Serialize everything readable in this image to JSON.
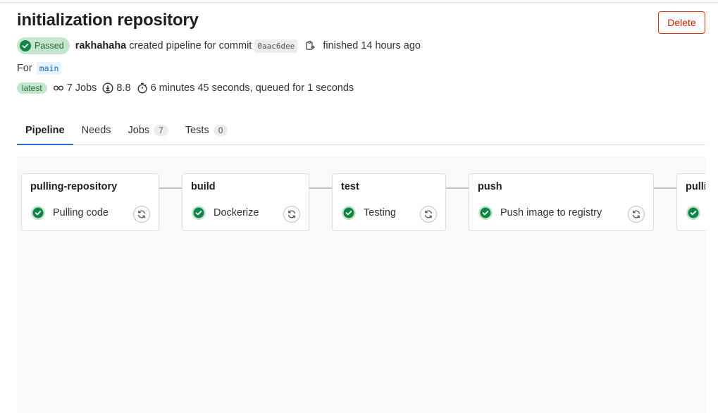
{
  "header": {
    "title": "initialization repository",
    "delete_label": "Delete"
  },
  "meta": {
    "status": "Passed",
    "author": "rakhahaha",
    "created_text": "created pipeline for commit",
    "sha": "0aac6dee",
    "finished_text": "finished 14 hours ago"
  },
  "ref": {
    "for_label": "For",
    "branch": "main"
  },
  "stats": {
    "latest_label": "latest",
    "jobs": "7 Jobs",
    "score": "8.8",
    "duration": "6 minutes 45 seconds, queued for 1 seconds"
  },
  "tabs": [
    {
      "label": "Pipeline"
    },
    {
      "label": "Needs"
    },
    {
      "label": "Jobs",
      "count": "7"
    },
    {
      "label": "Tests",
      "count": "0"
    }
  ],
  "stages": [
    {
      "name": "pulling-repository",
      "job": "Pulling code"
    },
    {
      "name": "build",
      "job": "Dockerize"
    },
    {
      "name": "test",
      "job": "Testing"
    },
    {
      "name": "push",
      "job": "Push image to registry"
    },
    {
      "name": "pulli",
      "job": ""
    }
  ],
  "colors": {
    "success": "#108548",
    "danger": "#dd2b0e",
    "link": "#1f75cb"
  }
}
